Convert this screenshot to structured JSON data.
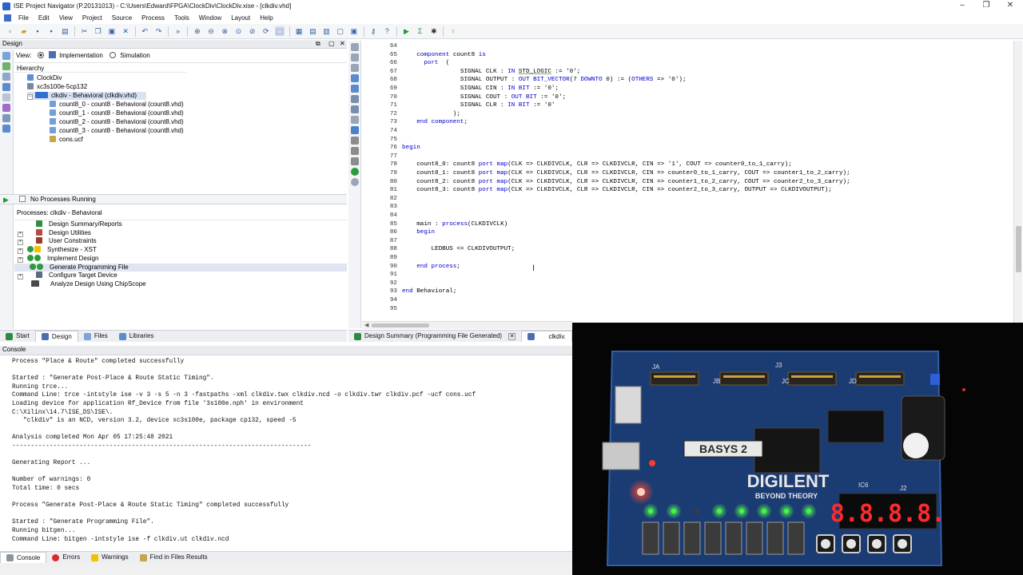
{
  "window": {
    "title": "ISE Project Navigator (P.20131013) - C:\\Users\\Edward\\FPGA\\ClockDiv\\ClockDiv.xise - [clkdiv.vhd]",
    "minimize": "–",
    "restore": "❐",
    "close": "✕"
  },
  "menu": [
    "File",
    "Edit",
    "View",
    "Project",
    "Source",
    "Process",
    "Tools",
    "Window",
    "Layout",
    "Help"
  ],
  "design_panel": {
    "title": "Design",
    "view_label": "View:",
    "view_options": [
      "Implementation",
      "Simulation"
    ],
    "selected_view": "Implementation",
    "hierarchy_label": "Hierarchy",
    "tree": [
      {
        "label": "ClockDiv",
        "level": 0,
        "icon": "project-icon"
      },
      {
        "label": "xc3s100e-5cp132",
        "level": 0,
        "icon": "device-icon"
      },
      {
        "label": "clkdiv - Behavioral (clkdiv.vhd)",
        "level": 1,
        "icon": "vhdl-top-icon",
        "selected": true
      },
      {
        "label": "count8_0 - count8 - Behavioral (count8.vhd)",
        "level": 2,
        "icon": "vhdl-file-icon"
      },
      {
        "label": "count8_1 - count8 - Behavioral (count8.vhd)",
        "level": 2,
        "icon": "vhdl-file-icon"
      },
      {
        "label": "count8_2 - count8 - Behavioral (count8.vhd)",
        "level": 2,
        "icon": "vhdl-file-icon"
      },
      {
        "label": "count8_3 - count8 - Behavioral (count8.vhd)",
        "level": 2,
        "icon": "vhdl-file-icon"
      },
      {
        "label": "cons.ucf",
        "level": 2,
        "icon": "ucf-file-icon"
      }
    ]
  },
  "processes_panel": {
    "status": "No Processes Running",
    "header": "Processes: clkdiv - Behavioral",
    "items": [
      {
        "label": "Design Summary/Reports",
        "icon": "summary-icon",
        "expander": false
      },
      {
        "label": "Design Utilities",
        "icon": "utilities-icon",
        "expander": true
      },
      {
        "label": "User Constraints",
        "icon": "constraints-icon",
        "expander": true
      },
      {
        "label": "Synthesize - XST",
        "icon": "warning-status-icon",
        "expander": true
      },
      {
        "label": "Implement Design",
        "icon": "done-status-icon",
        "expander": true
      },
      {
        "label": "Generate Programming File",
        "icon": "done-status-icon",
        "expander": false,
        "highlighted": true
      },
      {
        "label": "Configure Target Device",
        "icon": "target-device-icon",
        "expander": true
      },
      {
        "label": "Analyze Design Using ChipScope",
        "icon": "chipscope-icon",
        "expander": false
      }
    ]
  },
  "left_tabs": [
    "Start",
    "Design",
    "Files",
    "Libraries"
  ],
  "active_left_tab": "Design",
  "editor": {
    "lines": [
      {
        "n": "64",
        "code": ""
      },
      {
        "n": "65",
        "code": "    component count8 is"
      },
      {
        "n": "66",
        "code": "      port  ("
      },
      {
        "n": "67",
        "code": "                SIGNAL CLK : IN STD_LOGIC := '0';"
      },
      {
        "n": "68",
        "code": "                SIGNAL OUTPUT : OUT BIT_VECTOR(7 DOWNTO 0) := (OTHERS => '0');"
      },
      {
        "n": "69",
        "code": "                SIGNAL CIN : IN BIT := '0';"
      },
      {
        "n": "70",
        "code": "                SIGNAL COUT : OUT BIT := '0';"
      },
      {
        "n": "71",
        "code": "                SIGNAL CLR : IN BIT := '0'"
      },
      {
        "n": "72",
        "code": "              );"
      },
      {
        "n": "73",
        "code": "    end component;"
      },
      {
        "n": "74",
        "code": ""
      },
      {
        "n": "75",
        "code": ""
      },
      {
        "n": "76",
        "code": "begin"
      },
      {
        "n": "77",
        "code": ""
      },
      {
        "n": "78",
        "code": "    count8_0: count8 port map(CLK => CLKDIVCLK, CLR => CLKDIVCLR, CIN => '1', COUT => counter0_to_1_carry);"
      },
      {
        "n": "79",
        "code": "    count8_1: count8 port map(CLK => CLKDIVCLK, CLR => CLKDIVCLR, CIN => counter0_to_1_carry, COUT => counter1_to_2_carry);"
      },
      {
        "n": "80",
        "code": "    count8_2: count8 port map(CLK => CLKDIVCLK, CLR => CLKDIVCLR, CIN => counter1_to_2_carry, COUT => counter2_to_3_carry);"
      },
      {
        "n": "81",
        "code": "    count8_3: count8 port map(CLK => CLKDIVCLK, CLR => CLKDIVCLR, CIN => counter2_to_3_carry, OUTPUT => CLKDIVOUTPUT);"
      },
      {
        "n": "82",
        "code": ""
      },
      {
        "n": "83",
        "code": ""
      },
      {
        "n": "84",
        "code": ""
      },
      {
        "n": "85",
        "code": "    main : process(CLKDIVCLK)"
      },
      {
        "n": "86",
        "code": "    begin"
      },
      {
        "n": "87",
        "code": ""
      },
      {
        "n": "88",
        "code": "        LEDBUS <= CLKDIVOUTPUT;"
      },
      {
        "n": "89",
        "code": ""
      },
      {
        "n": "90",
        "code": "    end process;"
      },
      {
        "n": "91",
        "code": ""
      },
      {
        "n": "92",
        "code": ""
      },
      {
        "n": "93",
        "code": "end Behavioral;"
      },
      {
        "n": "94",
        "code": ""
      },
      {
        "n": "95",
        "code": ""
      }
    ],
    "keywords": [
      "component",
      "is",
      "port",
      "IN",
      "OUT",
      "BIT_VECTOR",
      "DOWNTO",
      "OTHERS",
      "BIT",
      "end",
      "begin",
      "map",
      "process",
      "STD_LOGIC"
    ],
    "syntax_colors": {
      "keyword": "#0000cc",
      "default": "#000000"
    }
  },
  "editor_tabs": [
    {
      "label": "Design Summary (Programming File Generated)",
      "active": false
    },
    {
      "label": "clkdiv.",
      "active": true
    }
  ],
  "console": {
    "title": "Console",
    "lines": [
      "Process \"Place & Route\" completed successfully",
      "",
      "Started : \"Generate Post-Place & Route Static Timing\".",
      "Running trce...",
      "Command Line: trce -intstyle ise -v 3 -s 5 -n 3 -fastpaths -xml clkdiv.twx clkdiv.ncd -o clkdiv.twr clkdiv.pcf -ucf cons.ucf",
      "Loading device for application Rf_Device from file '3s100e.nph' in environment",
      "C:\\Xilinx\\14.7\\ISE_DS\\ISE\\.",
      "   \"clkdiv\" is an NCD, version 3.2, device xc3s100e, package cp132, speed -5",
      "",
      "Analysis completed Mon Apr 05 17:25:48 2021",
      "--------------------------------------------------------------------------------",
      "",
      "Generating Report ...",
      "",
      "Number of warnings: 0",
      "Total time: 0 secs",
      "",
      "Process \"Generate Post-Place & Route Static Timing\" completed successfully",
      "",
      "Started : \"Generate Programming File\".",
      "Running bitgen...",
      "Command Line: bitgen -intstyle ise -f clkdiv.ut clkdiv.ncd"
    ],
    "tabs": [
      "Console",
      "Errors",
      "Warnings",
      "Find in Files Results"
    ],
    "active_tab": "Console"
  },
  "board": {
    "brand": "DIGILENT",
    "tagline": "BEYOND THEORY",
    "model": "BASYS 2",
    "seven_seg": "8.8.8.8.",
    "connector_labels": [
      "JA",
      "JB",
      "JC",
      "JD",
      "J3",
      "J2",
      "IC6"
    ],
    "leds_lit": [
      true,
      true,
      false,
      true,
      true,
      true,
      true,
      true
    ],
    "led_color": "#37ff3a",
    "seg_color": "#ff2a2a",
    "pcb_color": "#1b3b73"
  }
}
